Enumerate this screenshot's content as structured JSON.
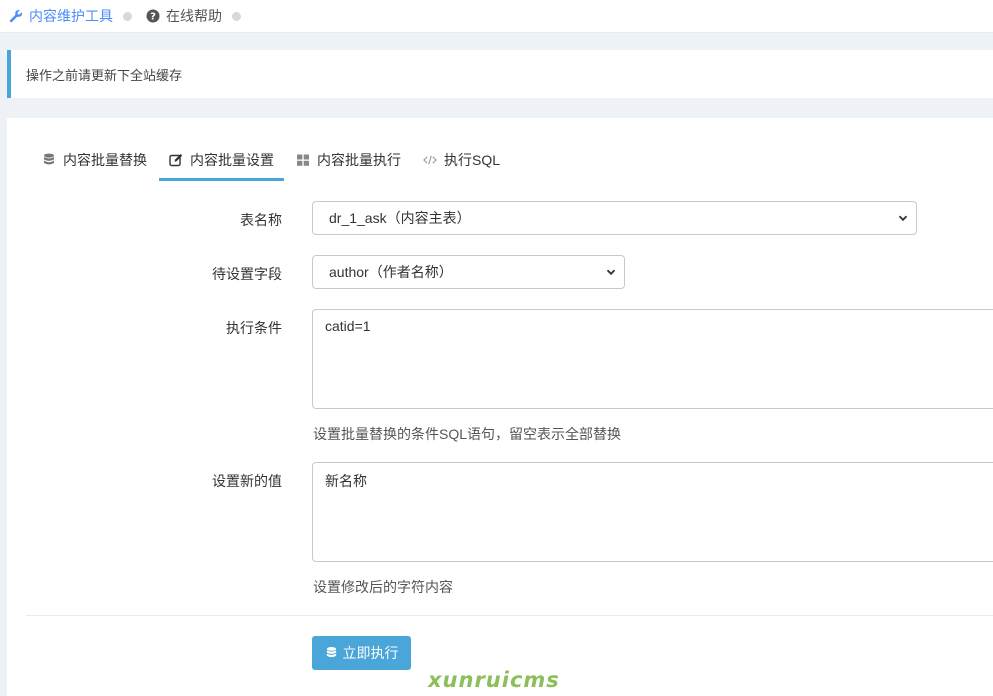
{
  "breadcrumb": {
    "items": [
      {
        "label": "内容维护工具",
        "icon": "wrench-icon",
        "active": true
      },
      {
        "label": "在线帮助",
        "icon": "question-circle-icon",
        "active": false
      }
    ]
  },
  "notice": {
    "text": "操作之前请更新下全站缓存"
  },
  "tabs": [
    {
      "label": "内容批量替换",
      "icon": "database-icon"
    },
    {
      "label": "内容批量设置",
      "icon": "edit-icon",
      "active": true
    },
    {
      "label": "内容批量执行",
      "icon": "grid-icon"
    },
    {
      "label": "执行SQL",
      "icon": "code-icon"
    }
  ],
  "form": {
    "table": {
      "label": "表名称",
      "value": "dr_1_ask（内容主表）"
    },
    "field": {
      "label": "待设置字段",
      "value": "author（作者名称）"
    },
    "condition": {
      "label": "执行条件",
      "value": "catid=1",
      "help": "设置批量替换的条件SQL语句，留空表示全部替换"
    },
    "new_value": {
      "label": "设置新的值",
      "value": "新名称",
      "help": "设置修改后的字符内容"
    }
  },
  "submit": {
    "label": "立即执行",
    "icon": "database-icon"
  },
  "watermark": "xunruicms",
  "colors": {
    "accent": "#4aa6d8",
    "link": "#4b8df8"
  }
}
